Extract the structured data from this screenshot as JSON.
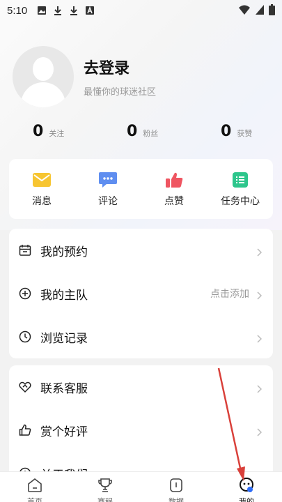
{
  "status_bar": {
    "time": "5:10",
    "icons": [
      "image-icon",
      "download-icon",
      "download-icon",
      "a-box-icon",
      "wifi-icon",
      "signal-icon",
      "battery-icon"
    ]
  },
  "profile": {
    "title": "去登录",
    "subtitle": "最懂你的球迷社区"
  },
  "stats": [
    {
      "value": "0",
      "label": "关注"
    },
    {
      "value": "0",
      "label": "粉丝"
    },
    {
      "value": "0",
      "label": "获赞"
    }
  ],
  "quick_actions": [
    {
      "label": "消息",
      "icon": "mail-icon",
      "color": "#f7c531"
    },
    {
      "label": "评论",
      "icon": "comment-icon",
      "color": "#5f8ef0"
    },
    {
      "label": "点赞",
      "icon": "thumbs-up-icon",
      "color": "#ef5561"
    },
    {
      "label": "任务中心",
      "icon": "task-list-icon",
      "color": "#2dc68c"
    }
  ],
  "menu_group1": [
    {
      "label": "我的预约",
      "icon": "calendar-icon",
      "extra": ""
    },
    {
      "label": "我的主队",
      "icon": "plus-circle-icon",
      "extra": "点击添加"
    },
    {
      "label": "浏览记录",
      "icon": "clock-icon",
      "extra": ""
    }
  ],
  "menu_group2": [
    {
      "label": "联系客服",
      "icon": "heart-handshake-icon"
    },
    {
      "label": "赏个好评",
      "icon": "thumbs-up-outline-icon"
    },
    {
      "label": "关于我们",
      "icon": "info-icon"
    }
  ],
  "tabs": [
    {
      "label": "首页",
      "icon": "home-icon"
    },
    {
      "label": "赛程",
      "icon": "trophy-icon"
    },
    {
      "label": "数据",
      "icon": "data-icon"
    },
    {
      "label": "我的",
      "icon": "profile-face-icon",
      "active": true
    }
  ],
  "colors": {
    "annotation_arrow": "#d9403a",
    "active_dot": "#2f6df6"
  }
}
